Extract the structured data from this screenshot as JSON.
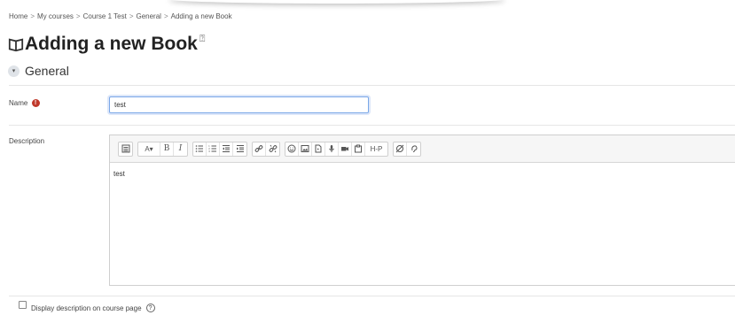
{
  "breadcrumb": {
    "items": [
      "Home",
      "My courses",
      "Course 1 Test",
      "General",
      "Adding a new Book"
    ],
    "separator": ">"
  },
  "page": {
    "title": "Adding a new Book",
    "help_glyph": "?"
  },
  "section": {
    "title": "General",
    "collapse_glyph": "▾"
  },
  "form": {
    "name_label": "Name",
    "required_glyph": "!",
    "name_value": "test",
    "description_label": "Description",
    "description_text": "test",
    "display_description_label": "Display description on course page",
    "help_glyph": "?"
  },
  "toolbar": {
    "bold": "B",
    "italic": "I",
    "font_size": "A▾",
    "h5p": "H-P"
  },
  "colors": {
    "required": "#c0392b",
    "input_focus": "#7aa7e8",
    "toolbar_bg": "#f6f6f6"
  }
}
